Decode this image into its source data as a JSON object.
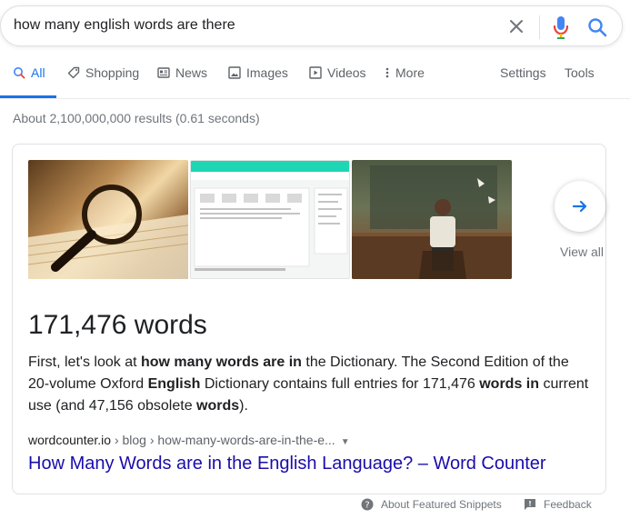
{
  "search": {
    "query": "how many english words are there",
    "icons": [
      "close-icon",
      "mic-icon",
      "search-icon"
    ]
  },
  "tabs": [
    {
      "label": "All",
      "icon": "search-icon",
      "active": true
    },
    {
      "label": "Shopping",
      "icon": "tag-icon",
      "active": false
    },
    {
      "label": "News",
      "icon": "newspaper-icon",
      "active": false
    },
    {
      "label": "Images",
      "icon": "image-icon",
      "active": false
    },
    {
      "label": "Videos",
      "icon": "play-icon",
      "active": false
    },
    {
      "label": "More",
      "icon": "more-vert-icon",
      "active": false
    }
  ],
  "tools": {
    "settings": "Settings",
    "tools": "Tools"
  },
  "result_stats": "About 2,100,000,000 results (0.61 seconds)",
  "snippet": {
    "view_all": "View all",
    "answer": "171,476 words",
    "text_parts": [
      "First, let's look at ",
      "how many words are in",
      " the Dictionary. The Second Edition of the 20-volume Oxford ",
      "English",
      " Dictionary contains full entries for 171,476 ",
      "words in",
      " current use (and 47,156 obsolete ",
      "words",
      ")."
    ],
    "breadcrumb_site": "wordcounter.io",
    "breadcrumb_path": " › blog › how-many-words-are-in-the-e...",
    "link_title": "How Many Words are in the English Language? – Word Counter"
  },
  "footer": {
    "about": "About Featured Snippets",
    "feedback": "Feedback"
  },
  "colors": {
    "accent": "#1a73e8",
    "link": "#1a0dab",
    "mic_red": "#ea4335",
    "text": "#202124",
    "muted": "#70757a"
  }
}
